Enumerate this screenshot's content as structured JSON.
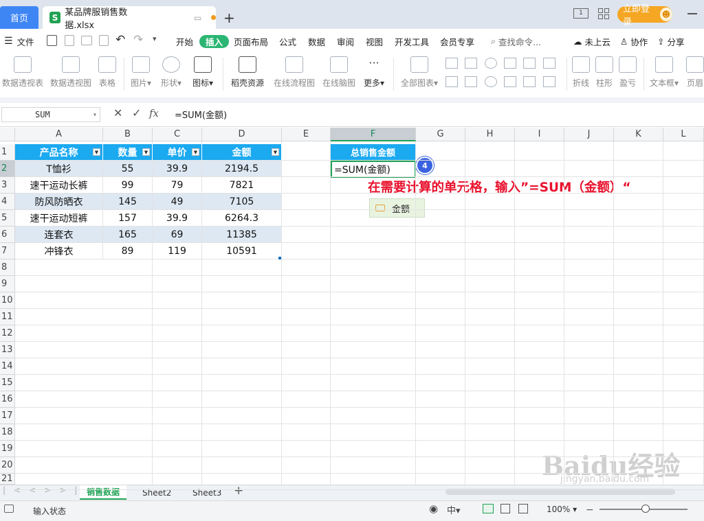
{
  "tabs": {
    "home": "首页",
    "file_title": "某品牌服销售数据.xlsx",
    "login": "立即登录"
  },
  "menu": {
    "file": "文件",
    "items": [
      "开始",
      "插入",
      "页面布局",
      "公式",
      "数据",
      "审阅",
      "视图",
      "开发工具",
      "会员专享"
    ],
    "active": "插入",
    "search": "查找命令...",
    "right": [
      "未上云",
      "协作",
      "分享"
    ]
  },
  "ribbon": {
    "items": [
      "数据透视表",
      "数据透视图",
      "表格",
      "图片",
      "形状",
      "图标",
      "稻壳资源",
      "在线流程图",
      "在线脑图",
      "更多",
      "全部图表",
      "折线",
      "柱形",
      "盈亏",
      "文本框",
      "页眉"
    ]
  },
  "formula_bar": {
    "name_box": "SUM",
    "fx": "fx",
    "formula": "=SUM(金额)"
  },
  "grid": {
    "columns": [
      "A",
      "B",
      "C",
      "D",
      "E",
      "F",
      "G",
      "H",
      "I",
      "J",
      "K",
      "L"
    ],
    "selected_column": "F",
    "rows": [
      "1",
      "2",
      "3",
      "4",
      "5",
      "6",
      "7",
      "8",
      "9",
      "10",
      "11",
      "12",
      "13",
      "14",
      "15",
      "16",
      "17",
      "18",
      "19",
      "20",
      "21"
    ],
    "selected_row": "2"
  },
  "table": {
    "headers": [
      "产品名称",
      "数量",
      "单价",
      "金额"
    ],
    "rows": [
      [
        "T恤衫",
        "55",
        "39.9",
        "2194.5"
      ],
      [
        "速干运动长裤",
        "99",
        "79",
        "7821"
      ],
      [
        "防风防晒衣",
        "145",
        "49",
        "7105"
      ],
      [
        "速干运动短裤",
        "157",
        "39.9",
        "6264.3"
      ],
      [
        "连套衣",
        "165",
        "69",
        "11385"
      ],
      [
        "冲锋衣",
        "89",
        "119",
        "10591"
      ]
    ]
  },
  "total": {
    "header": "总销售金额",
    "input": "=SUM(金额)"
  },
  "annotation": {
    "badge": "4",
    "text": "在需要计算的单元格，输入”=SUM（金额）“"
  },
  "suggestion": "金额",
  "sheets": [
    "销售数据",
    "Sheet2",
    "Sheet3"
  ],
  "status": {
    "mode": "输入状态",
    "zoom": "100%"
  },
  "watermark": {
    "logo": "Baidu经验",
    "url": "jingyan.baidu.com"
  }
}
